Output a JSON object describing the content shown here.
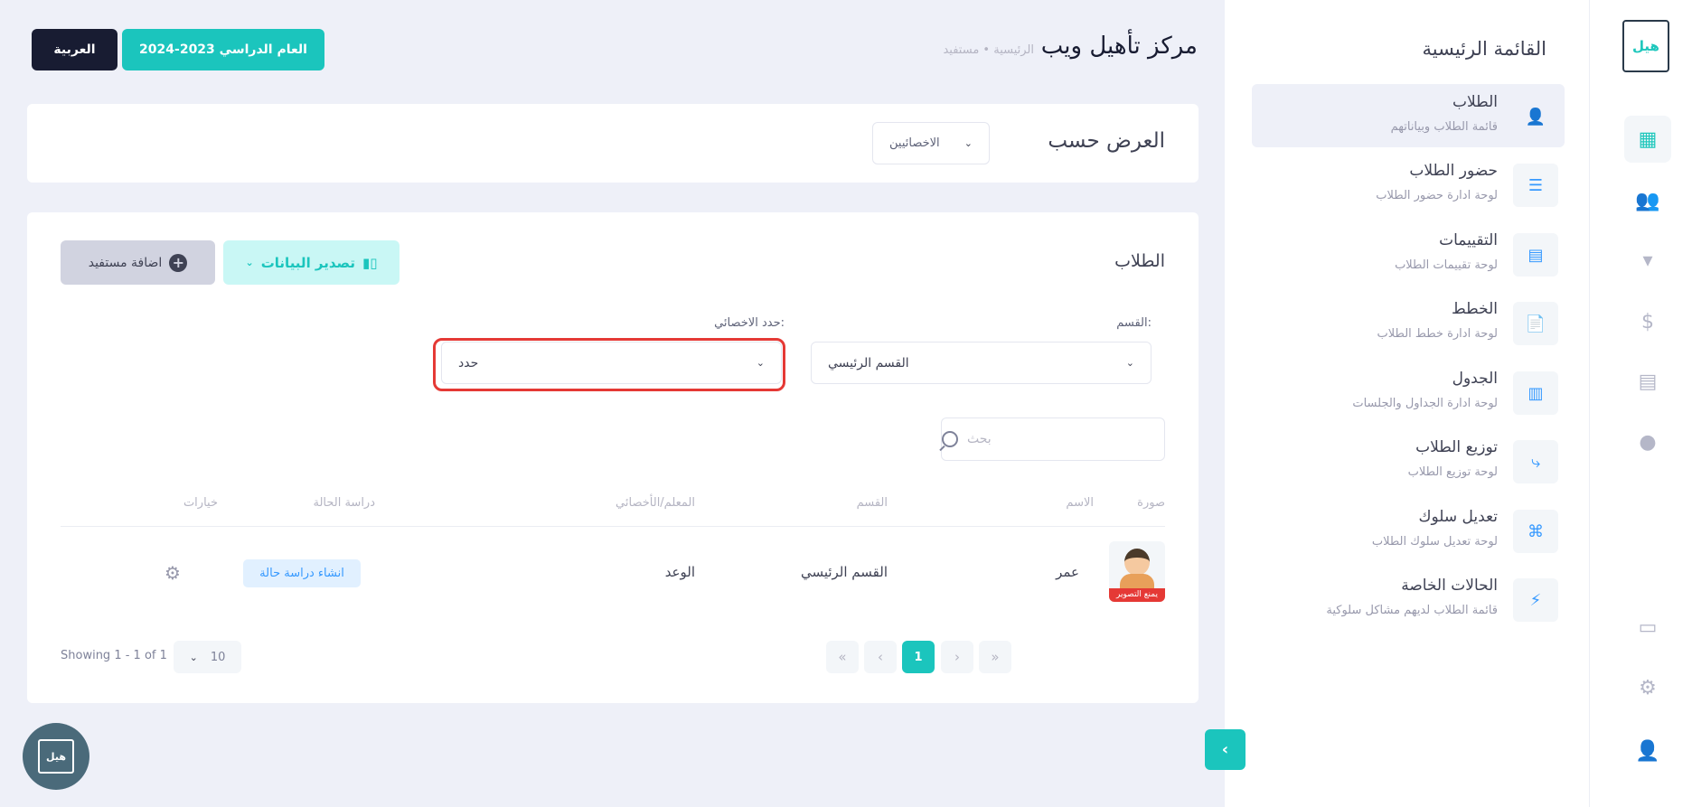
{
  "rail": {
    "logo_text": "هيل تأهيل",
    "icons": [
      "dashboard-icon",
      "users-icon",
      "tie-icon",
      "dollar-icon",
      "building-icon",
      "moon-icon",
      "chat-icon",
      "gear-icon",
      "user-icon"
    ]
  },
  "menu": {
    "title": "القائمة الرئيسية",
    "items": [
      {
        "label": "الطلاب",
        "sub": "قائمة الطلاب وبياناتهم",
        "icon": "👤"
      },
      {
        "label": "حضور الطلاب",
        "sub": "لوحة ادارة حضور الطلاب",
        "icon": "☰"
      },
      {
        "label": "التقييمات",
        "sub": "لوحة تقييمات الطلاب",
        "icon": "▤"
      },
      {
        "label": "الخطط",
        "sub": "لوحة ادارة خطط الطلاب",
        "icon": "📄"
      },
      {
        "label": "الجدول",
        "sub": "لوحة ادارة الجداول والجلسات",
        "icon": "▥"
      },
      {
        "label": "توزيع الطلاب",
        "sub": "لوحة توزيع الطلاب",
        "icon": "⤷"
      },
      {
        "label": "تعديل سلوك",
        "sub": "لوحة تعديل سلوك الطلاب",
        "icon": "⌘"
      },
      {
        "label": "الحالات الخاصة",
        "sub": "قائمة الطلاب لديهم مشاكل سلوكية",
        "icon": "⚡"
      }
    ]
  },
  "header": {
    "title": "مركز تأهيل ويب",
    "breadcrumb": "الرئيسية • مستفيد",
    "year_button": "العام الدراسي 2023-2024",
    "lang_button": "العربية"
  },
  "filter": {
    "label": "العرض حسب",
    "select_value": "الاخصائيين"
  },
  "students": {
    "title": "الطلاب",
    "export_button": "تصدير البيانات",
    "add_button": "اضافة مستفيد",
    "department_label": "القسم:",
    "department_value": "القسم الرئيسي",
    "specialist_label": "حدد الاخصائي:",
    "specialist_value": "حدد",
    "search_placeholder": "بحث",
    "columns": {
      "photo": "صورة",
      "name": "الاسم",
      "department": "القسم",
      "teacher": "المعلم/الأخصائي",
      "case_study": "دراسة الحالة",
      "options": "خيارات"
    },
    "rows": [
      {
        "name": "عمر",
        "department": "القسم الرئيسي",
        "teacher": "الوعد",
        "case_action": "انشاء دراسة حالة",
        "photo_ban": "يمنع التصوير"
      }
    ],
    "showing": "Showing 1 - 1 of 1",
    "page_size": "10",
    "current_page": "1",
    "pager": {
      "first": "«",
      "prev": "‹",
      "next": "›",
      "last": "»"
    }
  }
}
